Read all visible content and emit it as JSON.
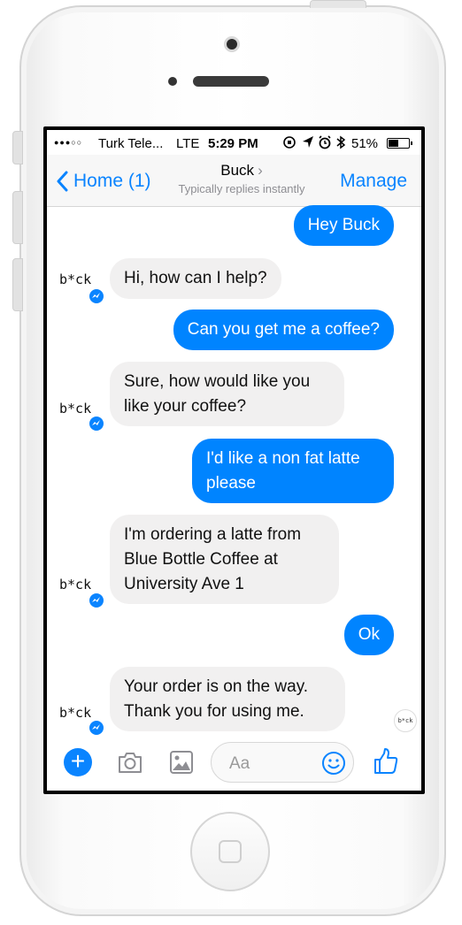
{
  "status_bar": {
    "carrier": "Turk Tele...",
    "network": "LTE",
    "time": "5:29 PM",
    "battery": "51%",
    "battery_level": 0.51
  },
  "nav": {
    "back_label": "Home (1)",
    "title": "Buck",
    "subtitle": "Typically replies instantly",
    "manage_label": "Manage"
  },
  "bot_avatar": "b*ck",
  "read_avatar": "b*ck",
  "messages": [
    {
      "from": "user",
      "text": "Hey Buck"
    },
    {
      "from": "bot",
      "text": "Hi, how can I help?"
    },
    {
      "from": "user",
      "text": "Can you get me a coffee?"
    },
    {
      "from": "bot",
      "lines": [
        "Sure, how would like you",
        "like your coffee?"
      ]
    },
    {
      "from": "user",
      "lines": [
        "I'd like a non fat latte",
        "please"
      ]
    },
    {
      "from": "bot",
      "lines": [
        "I'm ordering a latte from",
        "Blue Bottle Coffee at",
        "University Ave 1"
      ]
    },
    {
      "from": "user",
      "text": "Ok"
    },
    {
      "from": "bot",
      "lines": [
        "Your order is on the way.",
        "Thank you for using me."
      ]
    }
  ],
  "composer": {
    "placeholder": "Aa",
    "icons": [
      "plus-icon",
      "camera-icon",
      "image-icon",
      "emoji-icon",
      "thumbs-up-icon"
    ]
  },
  "colors": {
    "accent": "#0a84ff",
    "outgoing_bubble": "#0084ff",
    "incoming_bubble": "#f1f0f0"
  }
}
